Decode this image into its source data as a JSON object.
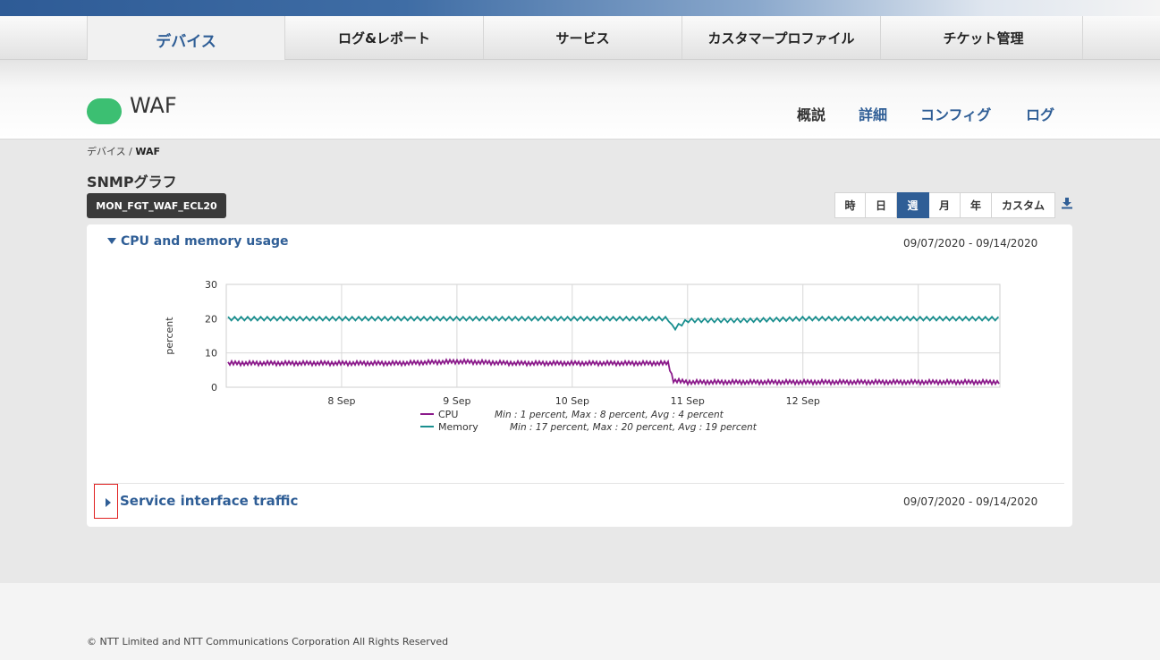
{
  "main_nav": {
    "tabs": [
      {
        "label": "デバイス",
        "active": true
      },
      {
        "label": "ログ&レポート",
        "active": false
      },
      {
        "label": "サービス",
        "active": false
      },
      {
        "label": "カスタマープロファイル",
        "active": false
      },
      {
        "label": "チケット管理",
        "active": false
      }
    ]
  },
  "device": {
    "name": "WAF",
    "status_color": "#3cbf72"
  },
  "sub_nav": {
    "items": [
      {
        "label": "概説",
        "color": "#333333"
      },
      {
        "label": "詳細",
        "color": "#2f5e96"
      },
      {
        "label": "コンフィグ",
        "color": "#2f5e96"
      },
      {
        "label": "ログ",
        "color": "#2f5e96"
      }
    ]
  },
  "breadcrumb": {
    "parent": "デバイス",
    "separator": " / ",
    "current": "WAF"
  },
  "section": {
    "title": "SNMPグラフ",
    "host": "MON_FGT_WAF_ECL20"
  },
  "time_range": {
    "buttons": [
      "時",
      "日",
      "週",
      "月",
      "年",
      "カスタム"
    ],
    "selected": "週"
  },
  "panels": [
    {
      "title": "CPU and memory usage",
      "date_range": "09/07/2020 - 09/14/2020",
      "expanded": true,
      "legend": [
        {
          "name": "CPU",
          "color": "#8b1a8b",
          "stats": "Min : 1 percent, Max : 8 percent, Avg : 4 percent"
        },
        {
          "name": "Memory",
          "color": "#1a8f8f",
          "stats": "Min : 17 percent, Max : 20 percent, Avg : 19 percent"
        }
      ]
    },
    {
      "title": "Service interface traffic",
      "date_range": "09/07/2020 - 09/14/2020",
      "expanded": false
    }
  ],
  "chart_data": {
    "type": "line",
    "ylabel": "percent",
    "xlabel": "",
    "ylim": [
      0,
      30
    ],
    "yticks": [
      "30",
      "20",
      "10",
      "0"
    ],
    "xticks": [
      "8 Sep",
      "9 Sep",
      "10 Sep",
      "11 Sep",
      "12 Sep"
    ],
    "grid": true,
    "series": [
      {
        "name": "Memory",
        "color": "#1a8f8f",
        "x": [
          "2020-09-07 00:00",
          "2020-09-07 12:00",
          "2020-09-08 00:00",
          "2020-09-08 12:00",
          "2020-09-09 00:00",
          "2020-09-09 12:00",
          "2020-09-10 00:00",
          "2020-09-10 12:00",
          "2020-09-10 20:00",
          "2020-09-10 21:00",
          "2020-09-11 00:00",
          "2020-09-11 12:00",
          "2020-09-12 00:00",
          "2020-09-12 12:00",
          "2020-09-13 00:00",
          "2020-09-13 12:00",
          "2020-09-13 17:00"
        ],
        "y": [
          20,
          20,
          20,
          20,
          20,
          20,
          20,
          20,
          20,
          17,
          19.5,
          19.5,
          20,
          20,
          20,
          20,
          20
        ]
      },
      {
        "name": "CPU",
        "color": "#8b1a8b",
        "x": [
          "2020-09-07 00:00",
          "2020-09-07 12:00",
          "2020-09-08 00:00",
          "2020-09-08 12:00",
          "2020-09-09 00:00",
          "2020-09-09 12:00",
          "2020-09-10 00:00",
          "2020-09-10 12:00",
          "2020-09-10 20:00",
          "2020-09-10 21:00",
          "2020-09-11 00:00",
          "2020-09-11 12:00",
          "2020-09-12 00:00",
          "2020-09-12 12:00",
          "2020-09-13 00:00",
          "2020-09-13 12:00",
          "2020-09-13 17:00"
        ],
        "y": [
          7,
          7,
          7,
          7,
          7.5,
          7,
          7,
          7,
          7,
          2,
          1.5,
          1.5,
          1.5,
          1.5,
          1.5,
          1.5,
          1.5
        ]
      }
    ]
  },
  "footer": {
    "copyright": "© NTT Limited and NTT Communications Corporation All Rights Reserved"
  }
}
